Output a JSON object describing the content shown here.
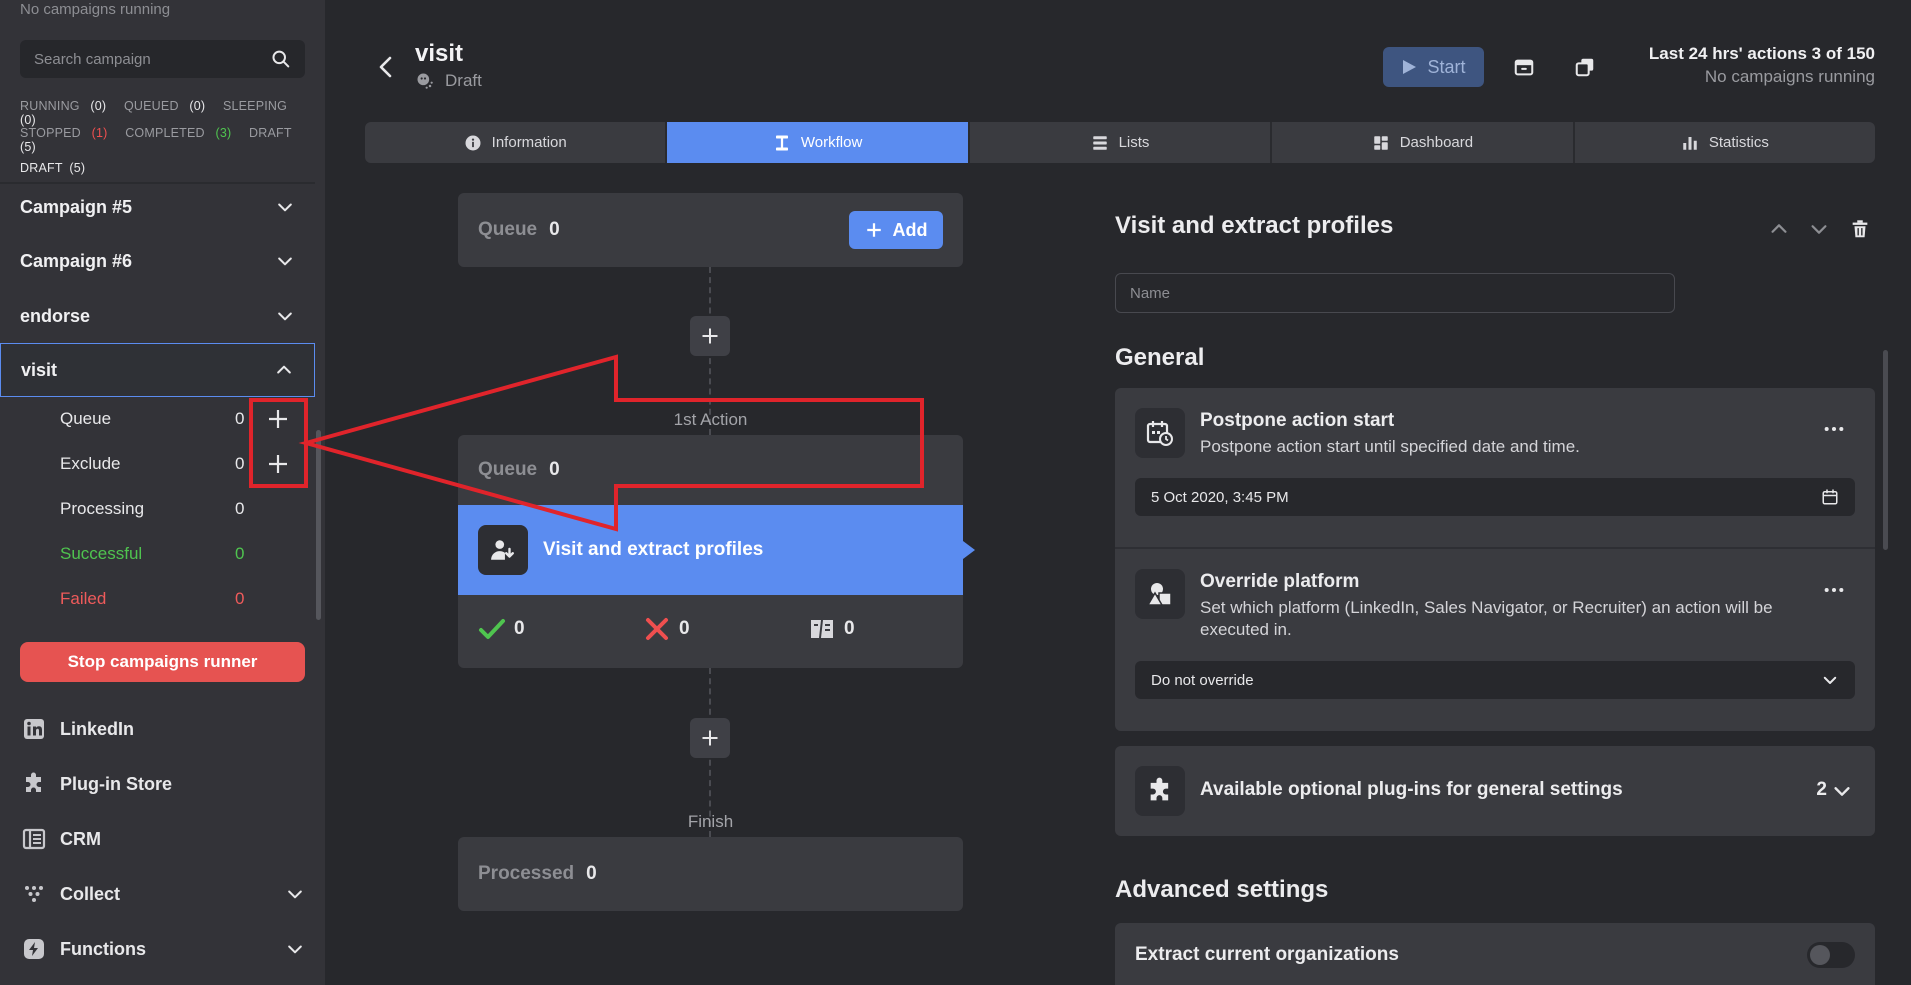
{
  "sidebar": {
    "status_text": "No campaigns running",
    "search_placeholder": "Search campaign",
    "filters_line1": [
      {
        "label": "RUNNING",
        "count": "(0)",
        "color": "white"
      },
      {
        "label": "QUEUED",
        "count": "(0)",
        "color": "white"
      },
      {
        "label": "SLEEPING",
        "count": "(0)",
        "color": "white"
      }
    ],
    "filters_line2": [
      {
        "label": "STOPPED",
        "count": "(1)",
        "color": "red"
      },
      {
        "label": "COMPLETED",
        "count": "(3)",
        "color": "green"
      },
      {
        "label": "DRAFT",
        "count": "(5)",
        "color": "white"
      }
    ],
    "filter_draft_label": "DRAFT",
    "filter_draft_count": "(5)",
    "campaigns": [
      {
        "label": "Campaign #5"
      },
      {
        "label": "Campaign #6"
      },
      {
        "label": "endorse"
      },
      {
        "label": "visit"
      }
    ],
    "visit_subitems": [
      {
        "label": "Queue",
        "count": "0"
      },
      {
        "label": "Exclude",
        "count": "0"
      },
      {
        "label": "Processing",
        "count": "0"
      },
      {
        "label": "Successful",
        "count": "0"
      },
      {
        "label": "Failed",
        "count": "0"
      }
    ],
    "stop_button": "Stop campaigns runner",
    "nav": [
      {
        "label": "LinkedIn",
        "icon": "linkedin-icon"
      },
      {
        "label": "Plug-in Store",
        "icon": "puzzle-icon"
      },
      {
        "label": "CRM",
        "icon": "crm-icon"
      },
      {
        "label": "Collect",
        "icon": "collect-icon"
      },
      {
        "label": "Functions",
        "icon": "functions-icon"
      }
    ]
  },
  "header": {
    "title": "visit",
    "subtitle": "Draft",
    "start_label": "Start",
    "actions_line": "Last 24 hrs' actions 3 of 150",
    "running_line": "No campaigns running"
  },
  "tabs": [
    {
      "label": "Information",
      "icon": "info-icon"
    },
    {
      "label": "Workflow",
      "icon": "workflow-icon"
    },
    {
      "label": "Lists",
      "icon": "lists-icon"
    },
    {
      "label": "Dashboard",
      "icon": "dashboard-icon"
    },
    {
      "label": "Statistics",
      "icon": "statistics-icon"
    }
  ],
  "workflow": {
    "queue_label": "Queue",
    "queue_count": "0",
    "add_label": "Add",
    "step_label": "1st Action",
    "action_queue_label": "Queue",
    "action_queue_count": "0",
    "action_title": "Visit and extract profiles",
    "success_count": "0",
    "failed_count": "0",
    "skipped_count": "0",
    "finish_label": "Finish",
    "processed_label": "Processed",
    "processed_count": "0"
  },
  "panel": {
    "title": "Visit and extract profiles",
    "name_placeholder": "Name",
    "general_heading": "General",
    "postpone_title": "Postpone action start",
    "postpone_desc": "Postpone action start until specified date and time.",
    "postpone_value": "5 Oct 2020, 3:45 PM",
    "override_title": "Override platform",
    "override_desc": "Set which platform (LinkedIn, Sales Navigator, or Recruiter) an action will be executed in.",
    "override_value": "Do not override",
    "plugins_label": "Available optional plug-ins for general settings",
    "plugins_count": "2",
    "advanced_heading": "Advanced settings",
    "extract_label": "Extract current organizations"
  },
  "colors": {
    "accent": "#5b8cf0",
    "danger": "#e65351",
    "success": "#4fc44f",
    "annotation": "#e0242b"
  }
}
